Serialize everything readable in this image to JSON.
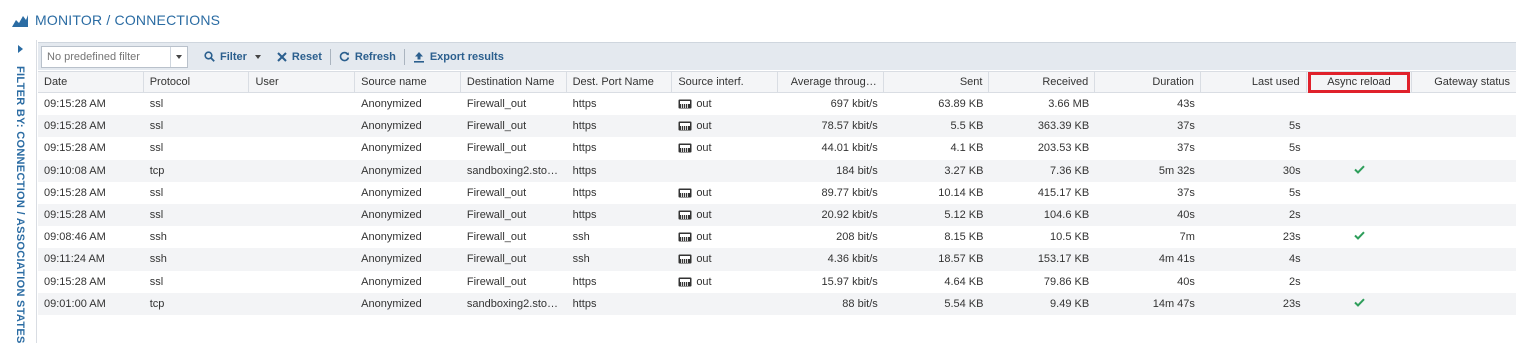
{
  "header": {
    "title": "MONITOR / CONNECTIONS"
  },
  "sidepanel": {
    "label": "FILTER BY: CONNECTION / ASSOCIATION STATES"
  },
  "toolbar": {
    "filter_placeholder": "No predefined filter",
    "filter_label": "Filter",
    "reset_label": "Reset",
    "refresh_label": "Refresh",
    "export_label": "Export results"
  },
  "columns": [
    "Date",
    "Protocol",
    "User",
    "Source name",
    "Destination Name",
    "Dest. Port Name",
    "Source interf.",
    "Average throug…",
    "Sent",
    "Received",
    "Duration",
    "Last used",
    "Async reload",
    "Gateway status"
  ],
  "rows": [
    {
      "date": "09:15:28 AM",
      "protocol": "ssl",
      "user": "",
      "source": "Anonymized",
      "dest": "Firewall_out",
      "port": "https",
      "iface": "out",
      "avg": "697 kbit/s",
      "sent": "63.89 KB",
      "received": "3.66 MB",
      "duration": "43s",
      "last_used": "",
      "async": false
    },
    {
      "date": "09:15:28 AM",
      "protocol": "ssl",
      "user": "",
      "source": "Anonymized",
      "dest": "Firewall_out",
      "port": "https",
      "iface": "out",
      "avg": "78.57 kbit/s",
      "sent": "5.5 KB",
      "received": "363.39 KB",
      "duration": "37s",
      "last_used": "5s",
      "async": false
    },
    {
      "date": "09:15:28 AM",
      "protocol": "ssl",
      "user": "",
      "source": "Anonymized",
      "dest": "Firewall_out",
      "port": "https",
      "iface": "out",
      "avg": "44.01 kbit/s",
      "sent": "4.1 KB",
      "received": "203.53 KB",
      "duration": "37s",
      "last_used": "5s",
      "async": false
    },
    {
      "date": "09:10:08 AM",
      "protocol": "tcp",
      "user": "",
      "source": "Anonymized",
      "dest": "sandboxing2.stor…",
      "port": "https",
      "iface": "",
      "avg": "184 bit/s",
      "sent": "3.27 KB",
      "received": "7.36 KB",
      "duration": "5m 32s",
      "last_used": "30s",
      "async": true
    },
    {
      "date": "09:15:28 AM",
      "protocol": "ssl",
      "user": "",
      "source": "Anonymized",
      "dest": "Firewall_out",
      "port": "https",
      "iface": "out",
      "avg": "89.77 kbit/s",
      "sent": "10.14 KB",
      "received": "415.17 KB",
      "duration": "37s",
      "last_used": "5s",
      "async": false
    },
    {
      "date": "09:15:28 AM",
      "protocol": "ssl",
      "user": "",
      "source": "Anonymized",
      "dest": "Firewall_out",
      "port": "https",
      "iface": "out",
      "avg": "20.92 kbit/s",
      "sent": "5.12 KB",
      "received": "104.6 KB",
      "duration": "40s",
      "last_used": "2s",
      "async": false
    },
    {
      "date": "09:08:46 AM",
      "protocol": "ssh",
      "user": "",
      "source": "Anonymized",
      "dest": "Firewall_out",
      "port": "ssh",
      "iface": "out",
      "avg": "208 bit/s",
      "sent": "8.15 KB",
      "received": "10.5 KB",
      "duration": "7m",
      "last_used": "23s",
      "async": true
    },
    {
      "date": "09:11:24 AM",
      "protocol": "ssh",
      "user": "",
      "source": "Anonymized",
      "dest": "Firewall_out",
      "port": "ssh",
      "iface": "out",
      "avg": "4.36 kbit/s",
      "sent": "18.57 KB",
      "received": "153.17 KB",
      "duration": "4m 41s",
      "last_used": "4s",
      "async": false
    },
    {
      "date": "09:15:28 AM",
      "protocol": "ssl",
      "user": "",
      "source": "Anonymized",
      "dest": "Firewall_out",
      "port": "https",
      "iface": "out",
      "avg": "15.97 kbit/s",
      "sent": "4.64 KB",
      "received": "79.86 KB",
      "duration": "40s",
      "last_used": "2s",
      "async": false
    },
    {
      "date": "09:01:00 AM",
      "protocol": "tcp",
      "user": "",
      "source": "Anonymized",
      "dest": "sandboxing2.stor…",
      "port": "https",
      "iface": "",
      "avg": "88 bit/s",
      "sent": "5.54 KB",
      "received": "9.49 KB",
      "duration": "14m 47s",
      "last_used": "23s",
      "async": true
    }
  ],
  "colors": {
    "accent": "#2b6ca3",
    "highlight": "#e0212b",
    "check": "#2e9e5b"
  }
}
